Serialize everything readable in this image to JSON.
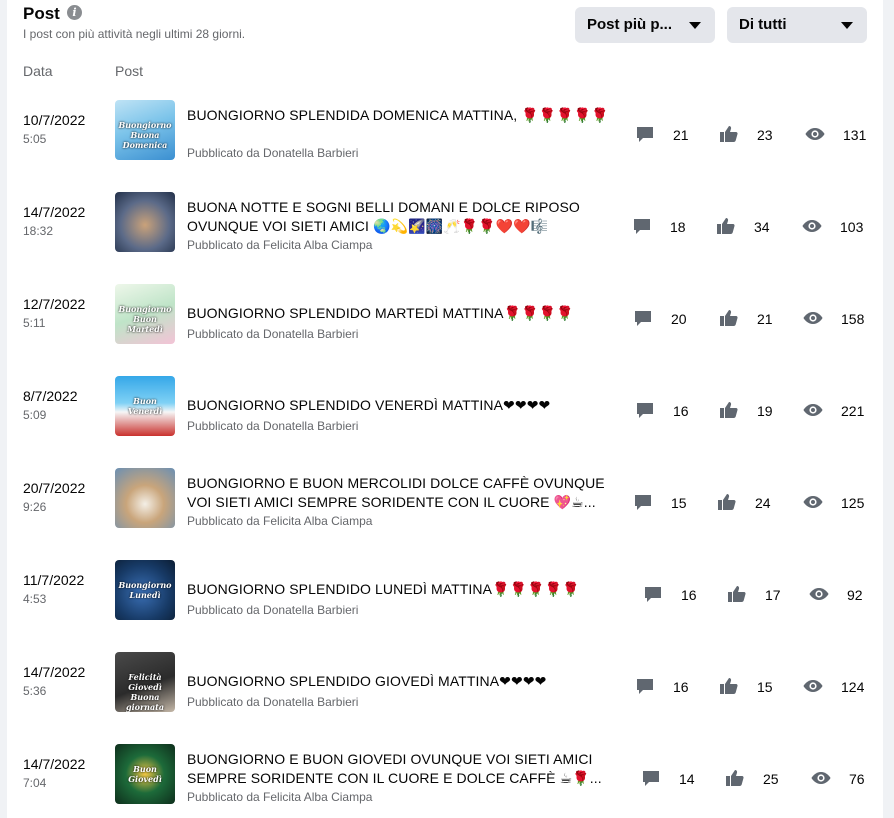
{
  "header": {
    "title": "Post",
    "subtitle": "I post con più attività negli ultimi 28 giorni.",
    "sort_dropdown": "Post più p...",
    "filter_dropdown": "Di tutti"
  },
  "columns": {
    "date": "Data",
    "post": "Post"
  },
  "posts": [
    {
      "date": "10/7/2022",
      "time": "5:05",
      "text": "BUONGIORNO SPLENDIDA DOMENICA MATTINA, 🌹🌹🌹🌹🌹",
      "author": "Pubblicato da Donatella Barbieri",
      "comments": "21",
      "likes": "23",
      "views": "131",
      "thumb": "Buongiorno Buona Domenica"
    },
    {
      "date": "14/7/2022",
      "time": "18:32",
      "text": "BUONA NOTTE E SOGNI BELLI DOMANI E DOLCE RIPOSO OVUNQUE VOI SIETI AMICI 🌏💫🌠🎆🥂🌹🌹❤️❤️🎼",
      "author": "Pubblicato da Felicita Alba Ciampa",
      "comments": "18",
      "likes": "34",
      "views": "103",
      "thumb": ""
    },
    {
      "date": "12/7/2022",
      "time": "5:11",
      "text": "BUONGIORNO SPLENDIDO MARTEDÌ MATTINA🌹🌹🌹🌹",
      "author": "Pubblicato da Donatella Barbieri",
      "comments": "20",
      "likes": "21",
      "views": "158",
      "thumb": "Buongiorno Buon Martedì"
    },
    {
      "date": "8/7/2022",
      "time": "5:09",
      "text": "BUONGIORNO SPLENDIDO VENERDÌ MATTINA❤❤❤❤",
      "author": "Pubblicato da Donatella Barbieri",
      "comments": "16",
      "likes": "19",
      "views": "221",
      "thumb": "Buon Venerdì"
    },
    {
      "date": "20/7/2022",
      "time": "9:26",
      "text": "BUONGIORNO E BUON MERCOLIDI DOLCE CAFFÈ OVUNQUE VOI SIETI AMICI SEMPRE SORIDENTE CON IL CUORE 💖☕...",
      "author": "Pubblicato da Felicita Alba Ciampa",
      "comments": "15",
      "likes": "24",
      "views": "125",
      "thumb": ""
    },
    {
      "date": "11/7/2022",
      "time": "4:53",
      "text": "BUONGIORNO SPLENDIDO LUNEDÌ MATTINA🌹🌹🌹🌹🌹",
      "author": "Pubblicato da Donatella Barbieri",
      "comments": "16",
      "likes": "17",
      "views": "92",
      "thumb": "Buongiorno Lunedì"
    },
    {
      "date": "14/7/2022",
      "time": "5:36",
      "text": "BUONGIORNO SPLENDIDO GIOVEDÌ MATTINA❤❤❤❤",
      "author": "Pubblicato da Donatella Barbieri",
      "comments": "16",
      "likes": "15",
      "views": "124",
      "thumb": "Felicità Giovedì Buona giornata"
    },
    {
      "date": "14/7/2022",
      "time": "7:04",
      "text": "BUONGIORNO E BUON GIOVEDI OVUNQUE VOI SIETI AMICI SEMPRE SORIDENTE CON IL CUORE E DOLCE CAFFÈ ☕🌹...",
      "author": "Pubblicato da Felicita Alba Ciampa",
      "comments": "14",
      "likes": "25",
      "views": "76",
      "thumb": "Buon Giovedì"
    }
  ],
  "colors": {
    "text_primary": "#050505",
    "text_secondary": "#65676b",
    "icon": "#606770",
    "dropdown_bg": "#e4e6eb"
  },
  "icons": {
    "comment": "comment-icon",
    "like": "thumbs-up-icon",
    "views": "eye-icon",
    "info": "info-icon"
  }
}
